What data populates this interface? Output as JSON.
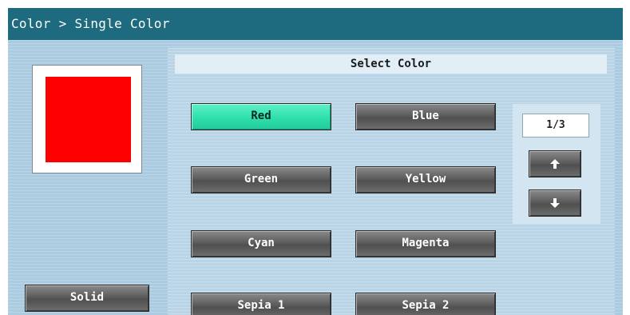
{
  "title": "Color > Single Color",
  "preview": {
    "swatch_color": "#ff0000"
  },
  "panel": {
    "header": "Select Color",
    "colors": [
      {
        "label": "Red",
        "selected": true
      },
      {
        "label": "Blue",
        "selected": false
      },
      {
        "label": "Green",
        "selected": false
      },
      {
        "label": "Yellow",
        "selected": false
      },
      {
        "label": "Cyan",
        "selected": false
      },
      {
        "label": "Magenta",
        "selected": false
      },
      {
        "label": "Sepia 1",
        "selected": false
      },
      {
        "label": "Sepia 2",
        "selected": false
      }
    ],
    "pager": {
      "page": "1/3",
      "up_icon": "arrow-up-icon",
      "down_icon": "arrow-down-icon"
    }
  },
  "solid_button": "Solid",
  "theme": {
    "titlebar": "#1e6a7e",
    "selected": "#2ee0ab",
    "button": "#5c5c5c"
  }
}
